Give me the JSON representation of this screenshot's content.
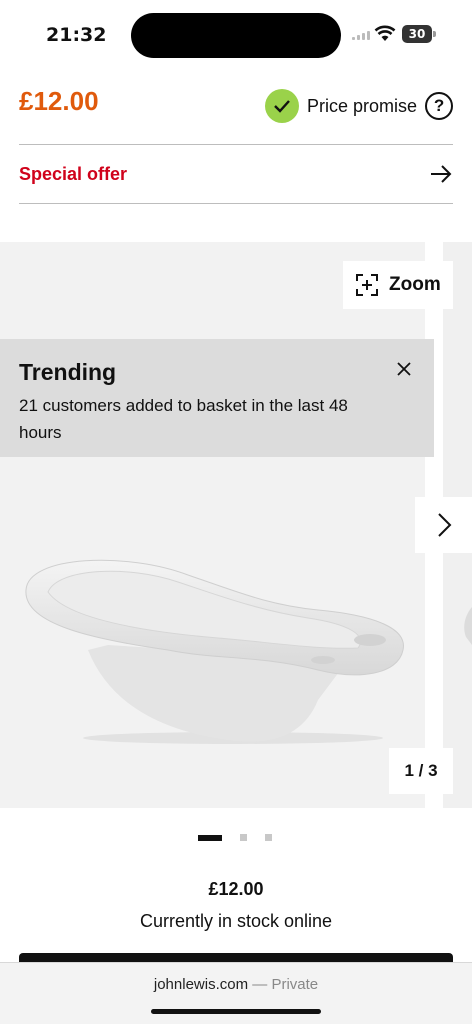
{
  "status_bar": {
    "time": "21:32",
    "battery": "30"
  },
  "product": {
    "price": "£12.00",
    "price_promise_label": "Price promise",
    "help_glyph": "?",
    "special_offer_label": "Special offer"
  },
  "gallery": {
    "zoom_label": "Zoom",
    "trending_title": "Trending",
    "trending_text": "21 customers added to basket in the last 48 hours",
    "counter": "1 / 3",
    "current_slide": 1,
    "total_slides": 3
  },
  "summary": {
    "price": "£12.00",
    "stock_status": "Currently in stock online"
  },
  "browser": {
    "domain": "johnlewis.com",
    "separator": " — ",
    "mode": "Private"
  },
  "colors": {
    "price": "#e05a0c",
    "offer": "#d0021b",
    "promise_badge": "#9ad24a"
  },
  "icons": [
    "check-icon",
    "help-icon",
    "arrow-right-icon",
    "zoom-icon",
    "close-icon",
    "chevron-right-icon",
    "wifi-icon",
    "battery-icon"
  ]
}
